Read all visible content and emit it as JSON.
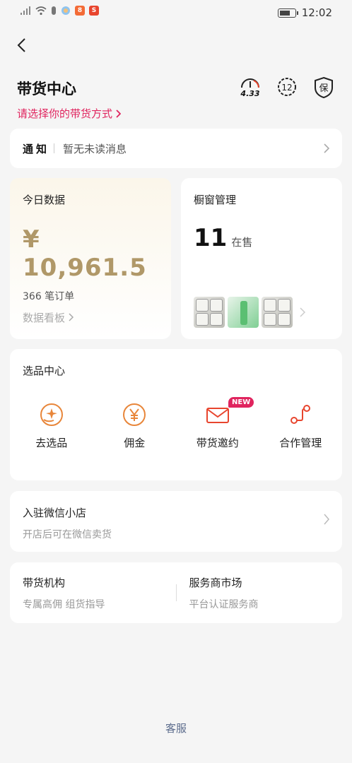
{
  "status_bar": {
    "time": "12:02",
    "app_badge_1": "8",
    "app_badge_2": "S"
  },
  "header": {
    "title": "带货中心",
    "subtitle": "请选择你的带货方式",
    "icons": [
      {
        "name": "speedometer-icon",
        "value": "4.33"
      },
      {
        "name": "badge-12-icon",
        "value": "12"
      },
      {
        "name": "shield-protect-icon",
        "value": "保"
      }
    ]
  },
  "notice": {
    "label": "通知",
    "message": "暂无未读消息"
  },
  "today_data": {
    "title": "今日数据",
    "amount": "¥ 10,961.5",
    "orders": "366 笔订单",
    "board_link": "数据看板"
  },
  "window_mgmt": {
    "title": "橱窗管理",
    "count": "11",
    "unit": "在售"
  },
  "select_center": {
    "title": "选品中心",
    "tools": [
      {
        "label": "去选品",
        "icon": "hand-star-icon"
      },
      {
        "label": "佣金",
        "icon": "yen-coin-icon"
      },
      {
        "label": "带货邀约",
        "icon": "envelope-icon",
        "badge": "NEW"
      },
      {
        "label": "合作管理",
        "icon": "path-connect-icon"
      }
    ]
  },
  "wechat_store": {
    "title": "入驻微信小店",
    "subtitle": "开店后可在微信卖货"
  },
  "agency": {
    "title": "带货机构",
    "subtitle": "专属高佣 组货指导"
  },
  "service_market": {
    "title": "服务商市场",
    "subtitle": "平台认证服务商"
  },
  "customer_service": "客服",
  "colors": {
    "accent": "#e0245e",
    "gold": "#b09868",
    "icon_orange": "#e8863a",
    "link_blue": "#5b6b8c"
  }
}
